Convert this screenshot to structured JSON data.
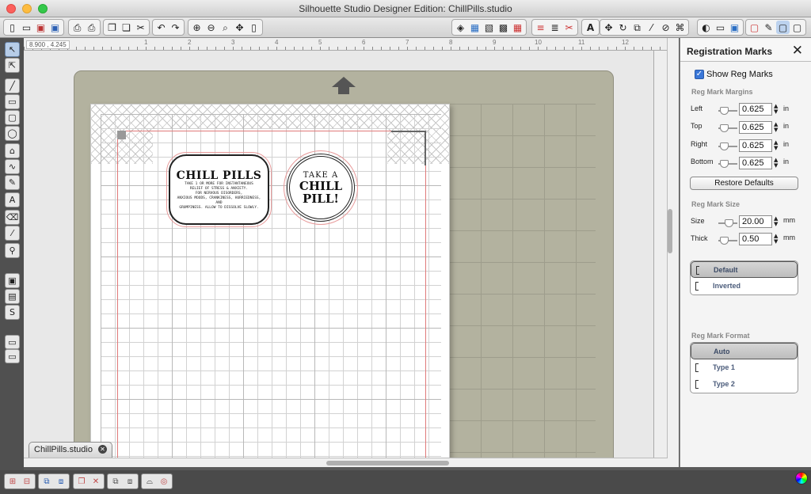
{
  "window": {
    "title": "Silhouette Studio Designer Edition: ChillPills.studio"
  },
  "toolbar": {
    "left_icons": [
      "new-document-icon",
      "open-icon",
      "save-icon",
      "save-to-library-icon",
      "print-icon",
      "print-cut-icon",
      "copy-icon",
      "paste-icon",
      "cut-icon",
      "undo-icon",
      "redo-icon",
      "zoom-in-icon",
      "zoom-out-icon",
      "zoom-selection-icon",
      "pan-icon",
      "fit-page-icon"
    ],
    "right_icons": [
      "fill-icon",
      "fill-color-icon",
      "fill-pattern-icon",
      "fill-gradient-icon",
      "line-color-icon",
      "line-style-icon",
      "cut-style-icon",
      "text-style-icon",
      "transform-icon",
      "replicate-icon",
      "modify-icon",
      "offset-icon",
      "trace-icon",
      "page-settings-icon",
      "cut-settings-icon",
      "registration-marks-icon"
    ]
  },
  "ruler": {
    "coordinates": "8.900 , 4.245",
    "numbers": [
      "1",
      "2",
      "3",
      "4",
      "5",
      "6",
      "7",
      "8",
      "9",
      "10",
      "11",
      "12"
    ]
  },
  "labels": {
    "rect_title": "CHILL PILLS",
    "rect_lines": [
      "TAKE 1 OR MORE FOR INSTANTANEOUS",
      "RELIEF OF STRESS & ANXIETY.",
      "FOR NERVOUS DISORDERS,",
      "ANXIOUS MOODS, CRANKINESS, HURRIEDNESS, AND",
      "GRUMPINESS. ALLOW TO DISSOLVE SLOWLY."
    ],
    "circle_line1": "TAKE A",
    "circle_line2": "CHILL",
    "circle_line3": "PILL!"
  },
  "doc_tab": {
    "label": "ChillPills.studio"
  },
  "panel": {
    "title": "Registration Marks",
    "show_label": "Show Reg Marks",
    "show_checked": true,
    "margins_head": "Reg Mark Margins",
    "margins": [
      {
        "label": "Left",
        "value": "0.625",
        "unit": "in"
      },
      {
        "label": "Top",
        "value": "0.625",
        "unit": "in"
      },
      {
        "label": "Right",
        "value": "0.625",
        "unit": "in"
      },
      {
        "label": "Bottom",
        "value": "0.625",
        "unit": "in"
      }
    ],
    "restore_label": "Restore Defaults",
    "size_head": "Reg Mark Size",
    "size": [
      {
        "label": "Size",
        "value": "20.00",
        "unit": "mm"
      },
      {
        "label": "Thick",
        "value": "0.50",
        "unit": "mm"
      }
    ],
    "style_options": [
      {
        "label": "Default",
        "selected": true
      },
      {
        "label": "Inverted",
        "selected": false
      }
    ],
    "format_head": "Reg Mark Format",
    "format_options": [
      {
        "label": "Auto",
        "selected": true
      },
      {
        "label": "Type 1",
        "selected": false
      },
      {
        "label": "Type 2",
        "selected": false
      }
    ]
  },
  "colors": {
    "mat": "#b3b29f",
    "cut_border": "#e07a7a",
    "selection": "#3a77d8"
  }
}
